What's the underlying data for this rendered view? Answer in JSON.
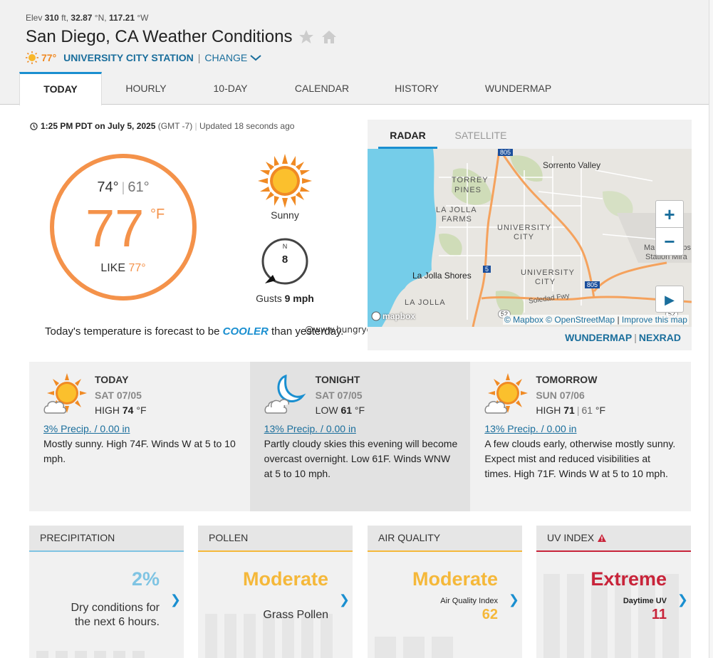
{
  "header": {
    "elev_label": "Elev",
    "elev_value": "310",
    "elev_unit": "ft,",
    "lat": "32.87",
    "lat_unit": "°N,",
    "lon": "117.21",
    "lon_unit": "°W",
    "title": "San Diego, CA Weather Conditions",
    "station_temp": "77°",
    "station_name": "UNIVERSITY CITY STATION",
    "separator": "|",
    "change_label": "CHANGE"
  },
  "tabs": [
    {
      "label": "TODAY",
      "active": true
    },
    {
      "label": "HOURLY"
    },
    {
      "label": "10-DAY"
    },
    {
      "label": "CALENDAR"
    },
    {
      "label": "HISTORY"
    },
    {
      "label": "WUNDERMAP"
    }
  ],
  "current": {
    "time": "1:25 PM PDT on July 5, 2025",
    "tz": "(GMT -7)",
    "updated": "Updated 18 seconds ago",
    "hi": "74°",
    "lo": "61°",
    "pipe": "|",
    "temp": "77",
    "unit": "°F",
    "like_label": "LIKE",
    "like_value": "77°",
    "condition": "Sunny",
    "wind_dir": "N",
    "wind_speed": "8",
    "gusts_label": "Gusts",
    "gusts_value": "9 mph",
    "compare_pre": "Today's temperature is forecast to be",
    "compare_word": "COOLER",
    "compare_post": "than yesterday.",
    "watermark": "@www.hungryones.com"
  },
  "radar": {
    "tab_radar": "RADAR",
    "tab_satellite": "SATELLITE",
    "zoom_in": "+",
    "zoom_out": "−",
    "play": "▶",
    "mapbox": "mapbox",
    "credit_mapbox": "© Mapbox",
    "credit_osm": "© OpenStreetMap",
    "credit_sep": "|",
    "credit_improve": "Improve this map",
    "link_wundermap": "WUNDERMAP",
    "link_sep": "|",
    "link_nexrad": "NEXRAD",
    "labels": {
      "sorrento": "Sorrento Valley",
      "torrey": "TORREY",
      "pines": "PINES",
      "lajolla": "LA JOLLA",
      "farms": "FARMS",
      "university": "UNIVERSITY",
      "city": "CITY",
      "shores": "La Jolla Shores",
      "lajolla2": "LA JOLLA",
      "university2": "UNIVERSITY",
      "city2": "CITY",
      "marine": "Marine Corps",
      "station": "Station Mira",
      "soledad": "Soledad Fwy",
      "r5": "5",
      "r805": "805",
      "r52": "52",
      "r52b": "52",
      "r805top": "805"
    }
  },
  "forecast": [
    {
      "head": "TODAY",
      "date": "SAT 07/05",
      "temp_label": "HIGH",
      "temp": "74",
      "unit": "°F",
      "precip": "3% Precip. / 0.00 in",
      "desc": "Mostly sunny. High 74F. Winds W at 5 to 10 mph."
    },
    {
      "head": "TONIGHT",
      "date": "SAT 07/05",
      "temp_label": "LOW",
      "temp": "61",
      "unit": "°F",
      "precip": "13% Precip. / 0.00 in",
      "desc": "Partly cloudy skies this evening will become overcast overnight. Low 61F. Winds WNW at 5 to 10 mph."
    },
    {
      "head": "TOMORROW",
      "date": "SUN 07/06",
      "temp_label": "HIGH",
      "temp": "71",
      "pipe": "|",
      "lo": "61",
      "unit": "°F",
      "precip": "13% Precip. / 0.00 in",
      "desc": "A few clouds early, otherwise mostly sunny. Expect mist and reduced visibilities at times. High 71F. Winds W at 5 to 10 mph."
    }
  ],
  "cards": {
    "precip": {
      "title": "PRECIPITATION",
      "value": "2%",
      "sub1": "Dry conditions for",
      "sub2": "the next 6 hours."
    },
    "pollen": {
      "title": "POLLEN",
      "value": "Moderate",
      "sub": "Grass Pollen"
    },
    "air": {
      "title": "AIR QUALITY",
      "value": "Moderate",
      "sub_label": "Air Quality Index",
      "sub_value": "62"
    },
    "uv": {
      "title": "UV INDEX",
      "value": "Extreme",
      "sub_label": "Daytime UV",
      "sub_value": "11"
    }
  },
  "colors": {
    "accent_blue": "#1a8fd0",
    "link_blue": "#1a6e9c",
    "temp_orange": "#f4924a",
    "moderate_yellow": "#f5b83a",
    "extreme_red": "#c8243a",
    "precip_blue": "#7fc4e3"
  }
}
